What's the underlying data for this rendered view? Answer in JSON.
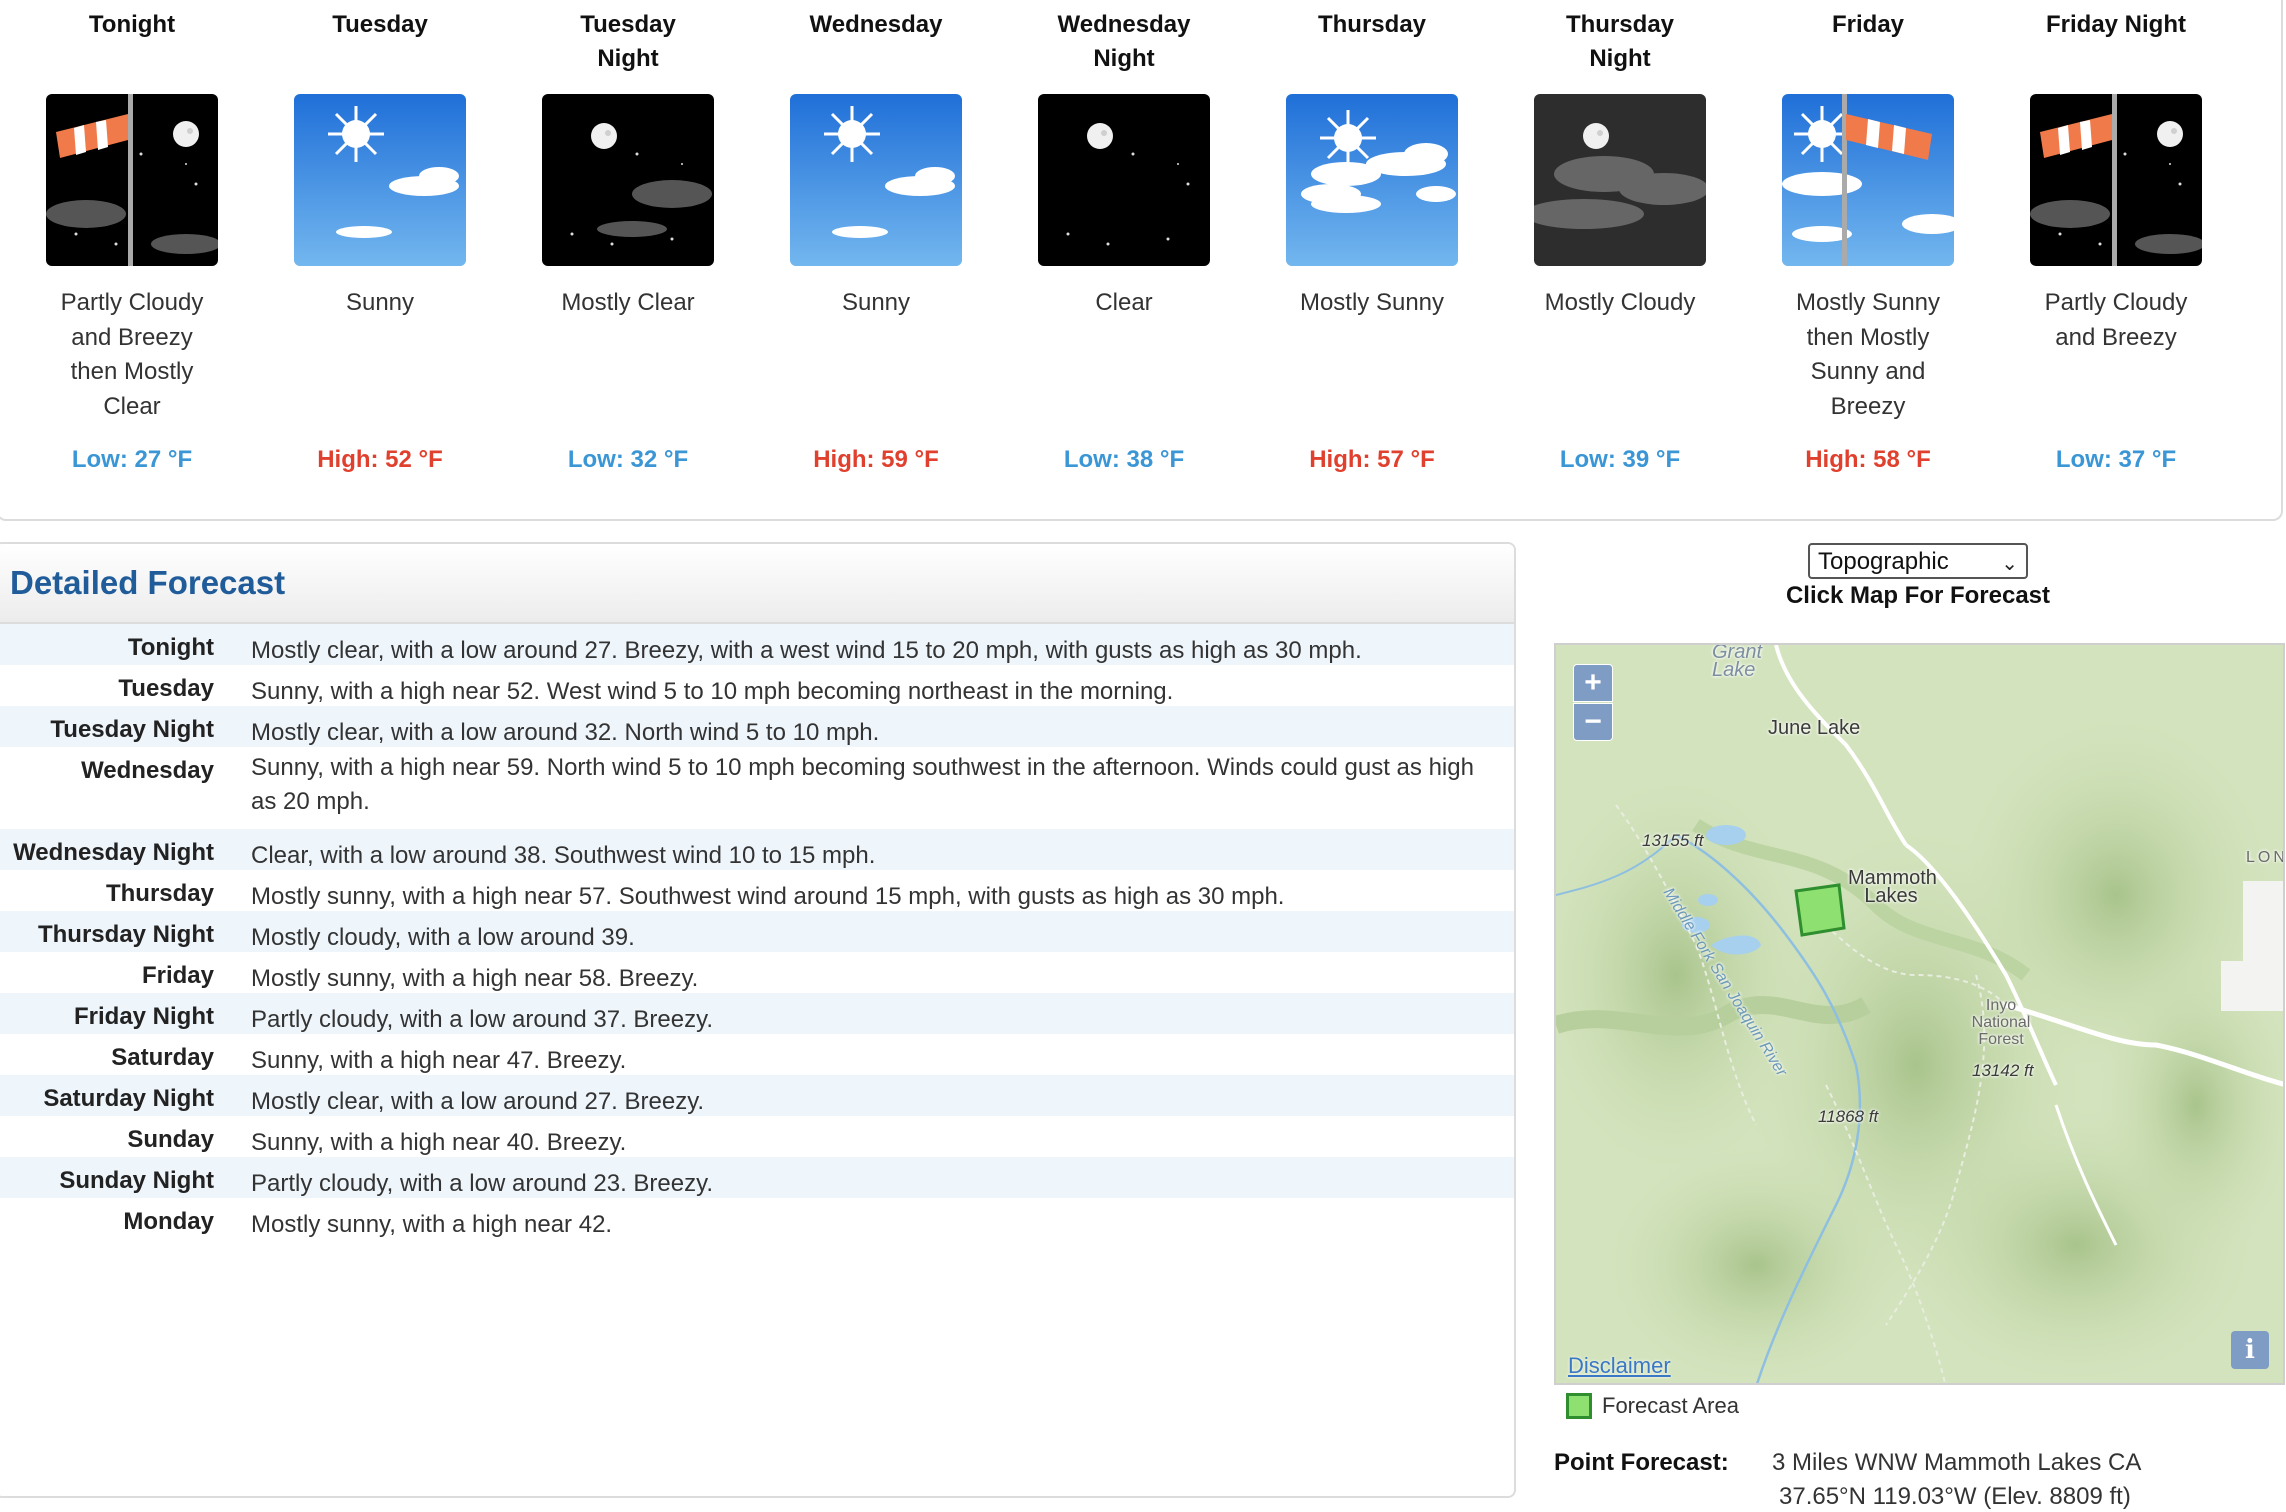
{
  "periods": [
    {
      "name": "Tonight",
      "icon": "night-wind-partly-cloudy",
      "short": "Partly Cloudy and Breezy then Mostly Clear",
      "temp_label": "Low: 27 °F",
      "kind": "low"
    },
    {
      "name": "Tuesday",
      "icon": "day-sunny",
      "short": "Sunny",
      "temp_label": "High: 52 °F",
      "kind": "high"
    },
    {
      "name": "Tuesday Night",
      "icon": "night-mostly-clear",
      "short": "Mostly Clear",
      "temp_label": "Low: 32 °F",
      "kind": "low"
    },
    {
      "name": "Wednesday",
      "icon": "day-sunny",
      "short": "Sunny",
      "temp_label": "High: 59 °F",
      "kind": "high"
    },
    {
      "name": "Wednesday Night",
      "icon": "night-clear",
      "short": "Clear",
      "temp_label": "Low: 38 °F",
      "kind": "low"
    },
    {
      "name": "Thursday",
      "icon": "day-mostly-sunny",
      "short": "Mostly Sunny",
      "temp_label": "High: 57 °F",
      "kind": "high"
    },
    {
      "name": "Thursday Night",
      "icon": "night-mostly-cloudy",
      "short": "Mostly Cloudy",
      "temp_label": "Low: 39 °F",
      "kind": "low"
    },
    {
      "name": "Friday",
      "icon": "day-mostly-sunny-wind",
      "short": "Mostly Sunny then Mostly Sunny and Breezy",
      "temp_label": "High: 58 °F",
      "kind": "high"
    },
    {
      "name": "Friday Night",
      "icon": "night-wind-partly-cloudy",
      "short": "Partly Cloudy and Breezy",
      "temp_label": "Low: 37 °F",
      "kind": "low"
    }
  ],
  "detailed": {
    "title": "Detailed Forecast",
    "rows": [
      {
        "label": "Tonight",
        "text": "Mostly clear, with a low around 27. Breezy, with a west wind 15 to 20 mph, with gusts as high as 30 mph."
      },
      {
        "label": "Tuesday",
        "text": "Sunny, with a high near 52. West wind 5 to 10 mph becoming northeast in the morning."
      },
      {
        "label": "Tuesday Night",
        "text": "Mostly clear, with a low around 32. North wind 5 to 10 mph."
      },
      {
        "label": "Wednesday",
        "text": "Sunny, with a high near 59. North wind 5 to 10 mph becoming southwest in the afternoon. Winds could gust as high as 20 mph."
      },
      {
        "label": "Wednesday Night",
        "text": "Clear, with a low around 38. Southwest wind 10 to 15 mph."
      },
      {
        "label": "Thursday",
        "text": "Mostly sunny, with a high near 57. Southwest wind around 15 mph, with gusts as high as 30 mph."
      },
      {
        "label": "Thursday Night",
        "text": "Mostly cloudy, with a low around 39."
      },
      {
        "label": "Friday",
        "text": "Mostly sunny, with a high near 58. Breezy."
      },
      {
        "label": "Friday Night",
        "text": "Partly cloudy, with a low around 37. Breezy."
      },
      {
        "label": "Saturday",
        "text": "Sunny, with a high near 47. Breezy."
      },
      {
        "label": "Saturday Night",
        "text": "Mostly clear, with a low around 27. Breezy."
      },
      {
        "label": "Sunday",
        "text": "Sunny, with a high near 40. Breezy."
      },
      {
        "label": "Sunday Night",
        "text": "Partly cloudy, with a low around 23. Breezy."
      },
      {
        "label": "Monday",
        "text": "Mostly sunny, with a high near 42."
      }
    ]
  },
  "map": {
    "select_value": "Topographic",
    "caption": "Click Map For Forecast",
    "zoom_in": "+",
    "zoom_out": "−",
    "labels": {
      "grant_lake": "Grant Lake",
      "june_lake": "June Lake",
      "mammoth_lakes": "Mammoth Lakes",
      "middle_fork": "Middle Fork San Joaquin River",
      "elev_13155": "13155 ft",
      "elev_13142": "13142 ft",
      "elev_11868": "11868 ft",
      "inyo": "Inyo National Forest",
      "lon": "LON"
    },
    "info": "i",
    "disclaimer": "Disclaimer",
    "legend_label": "Forecast Area"
  },
  "point": {
    "label": "Point Forecast:",
    "location": "3 Miles WNW Mammoth Lakes CA",
    "coords": "37.65°N 119.03°W (Elev. 8809 ft)"
  },
  "colors": {
    "low": "#3b96d6",
    "high": "#e0412f",
    "title": "#1f5c99",
    "forecast_area": "#8ee070"
  }
}
